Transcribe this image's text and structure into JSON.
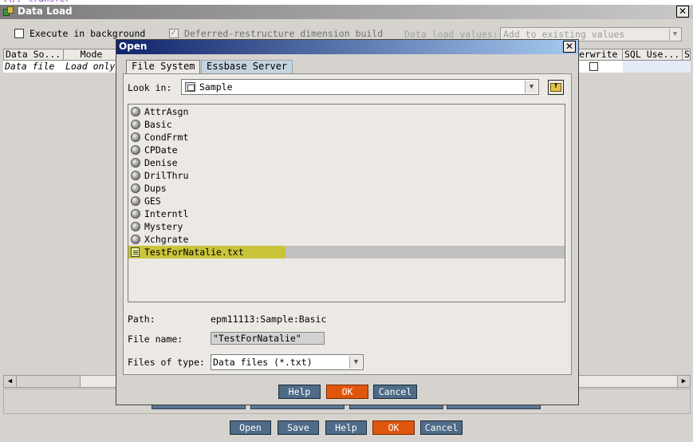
{
  "data_load": {
    "title": "Data Load",
    "close_label": "✕",
    "execute_in_background": "Execute in background",
    "deferred_restructure": "Deferred-restructure dimension build",
    "data_load_values_label": "Data load values:",
    "data_load_values_selected": "Add to existing values",
    "columns": [
      "Data So...",
      "Mode",
      "erwrite",
      "SQL Use...",
      "S"
    ],
    "row": {
      "data_source": "Data file",
      "mode": "Load only"
    },
    "buttons": {
      "open": "Open",
      "save": "Save",
      "help": "Help",
      "ok": "OK",
      "cancel": "Cancel"
    }
  },
  "open_dialog": {
    "title": "Open",
    "close_label": "✕",
    "tabs": [
      "File System",
      "Essbase Server"
    ],
    "look_in_label": "Look in:",
    "look_in_value": "Sample",
    "files": [
      {
        "name": "AttrAsgn",
        "icon": "database-icon"
      },
      {
        "name": "Basic",
        "icon": "database-icon"
      },
      {
        "name": "CondFrmt",
        "icon": "database-icon"
      },
      {
        "name": "CPDate",
        "icon": "database-icon"
      },
      {
        "name": "Denise",
        "icon": "database-icon"
      },
      {
        "name": "DrilThru",
        "icon": "database-icon"
      },
      {
        "name": "Dups",
        "icon": "database-icon"
      },
      {
        "name": "GES",
        "icon": "database-icon"
      },
      {
        "name": "Interntl",
        "icon": "database-icon"
      },
      {
        "name": "Mystery",
        "icon": "database-icon"
      },
      {
        "name": "Xchgrate",
        "icon": "database-icon"
      },
      {
        "name": "TestForNatalie.txt",
        "icon": "text-file-icon",
        "selected": true
      }
    ],
    "path_label": "Path:",
    "path_value": "epm11113:Sample:Basic",
    "file_name_label": "File name:",
    "file_name_value": "\"TestForNatalie\"",
    "files_of_type_label": "Files of type:",
    "files_of_type_value": "Data files (*.txt)",
    "buttons": {
      "help": "Help",
      "ok": "OK",
      "cancel": "Cancel"
    }
  },
  "colors": {
    "ok_button": "#e0560d",
    "button": "#4e6b88",
    "selection_highlight": "#c9c43a",
    "dialog_title": "#10246a"
  }
}
